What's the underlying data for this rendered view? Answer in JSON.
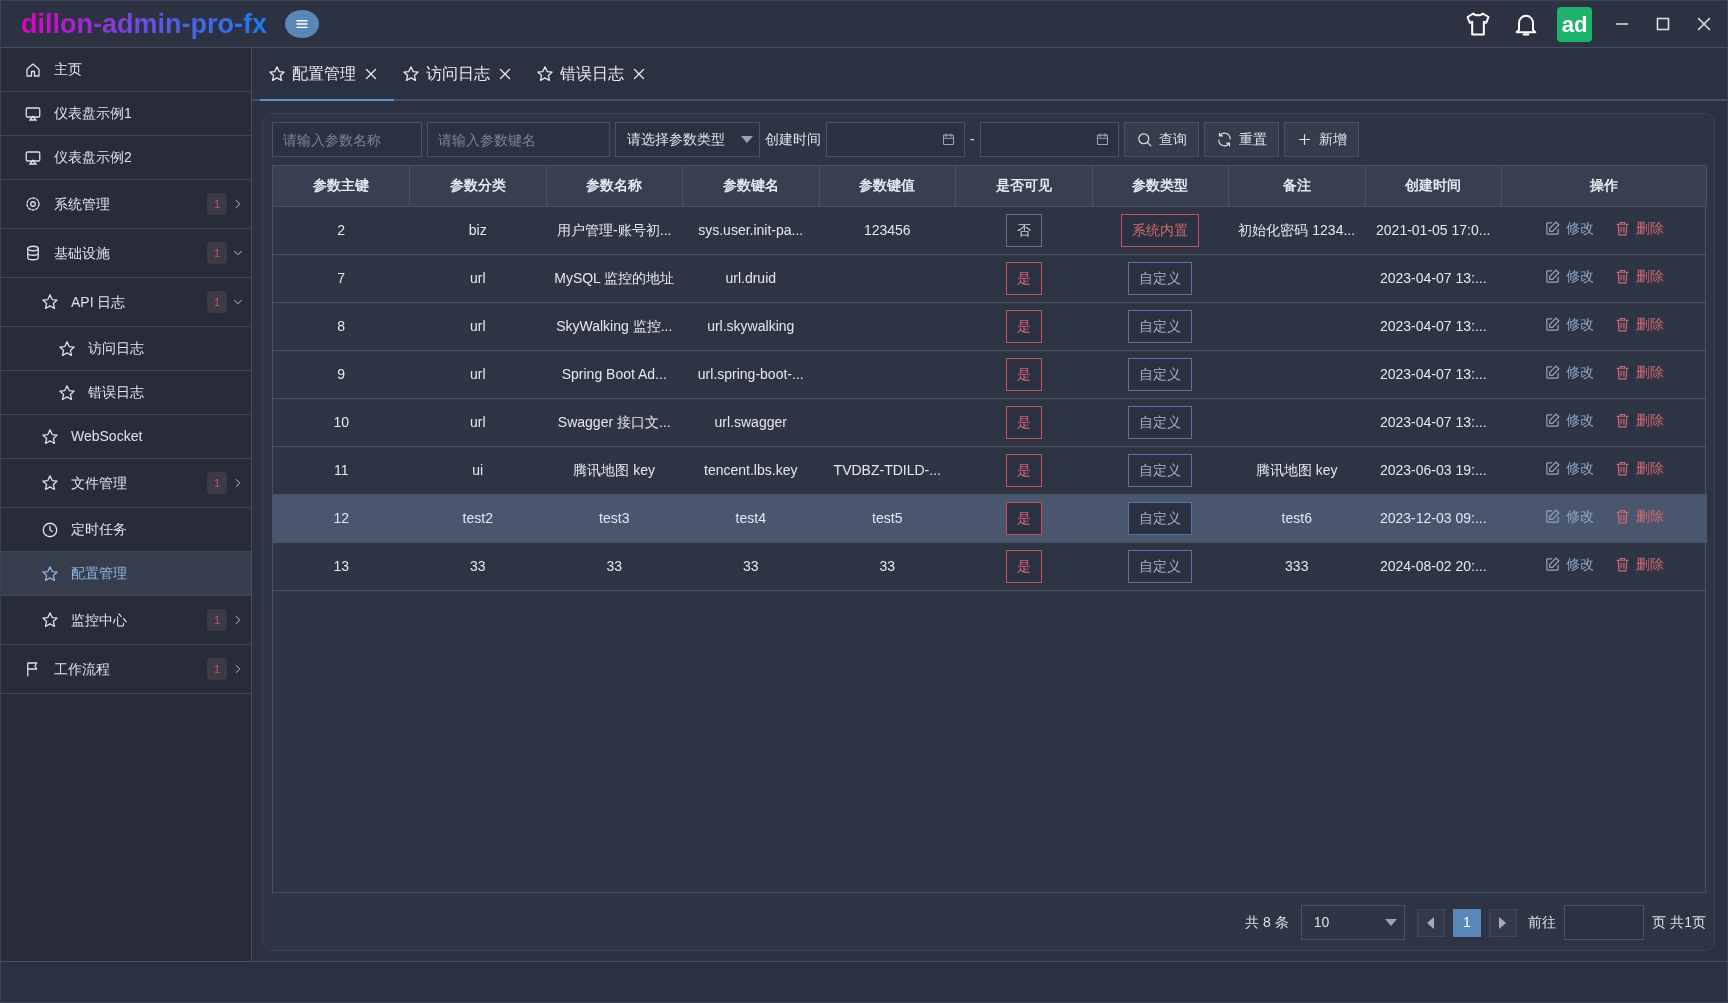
{
  "header": {
    "title": "dillon-admin-pro-fx",
    "avatar": "ad"
  },
  "sidebar": {
    "items": [
      {
        "label": "主页",
        "kind": "home",
        "selected": false
      },
      {
        "label": "仪表盘示例1",
        "kind": "monitor",
        "selected": false
      },
      {
        "label": "仪表盘示例2",
        "kind": "monitor",
        "selected": false
      },
      {
        "label": "系统管理",
        "kind": "gear",
        "selected": false,
        "badge": "1",
        "expanded": false
      },
      {
        "label": "基础设施",
        "kind": "database",
        "selected": false,
        "badge": "1",
        "expanded": true,
        "children": [
          {
            "label": "API 日志",
            "kind": "star",
            "selected": false,
            "badge": "1",
            "expanded": true,
            "children": [
              {
                "label": "访问日志",
                "kind": "star",
                "selected": false
              },
              {
                "label": "错误日志",
                "kind": "star",
                "selected": false
              }
            ]
          },
          {
            "label": "WebSocket",
            "kind": "star",
            "selected": false
          },
          {
            "label": "文件管理",
            "kind": "star",
            "selected": false,
            "badge": "1",
            "expanded": false
          },
          {
            "label": "定时任务",
            "kind": "clock",
            "selected": false
          },
          {
            "label": "配置管理",
            "kind": "star",
            "selected": true
          },
          {
            "label": "监控中心",
            "kind": "star",
            "selected": false,
            "badge": "1",
            "expanded": false
          }
        ]
      },
      {
        "label": "工作流程",
        "kind": "flag",
        "selected": false,
        "badge": "1",
        "expanded": false
      }
    ]
  },
  "tabs": [
    {
      "label": "配置管理",
      "selected": true
    },
    {
      "label": "访问日志",
      "selected": false
    },
    {
      "label": "错误日志",
      "selected": false
    }
  ],
  "toolbar": {
    "name_field": {
      "placeholder": "请输入参数名称"
    },
    "key_field": {
      "placeholder": "请输入参数键名"
    },
    "type_select": {
      "placeholder": "请选择参数类型"
    },
    "date_label": "创建时间",
    "date_separator": "-",
    "buttons": [
      {
        "label": "查询",
        "kind": "search"
      },
      {
        "label": "重置",
        "kind": "reset"
      },
      {
        "label": "新增",
        "kind": "add"
      }
    ]
  },
  "table": {
    "columns": [
      "参数主键",
      "参数分类",
      "参数名称",
      "参数键名",
      "参数键值",
      "是否可见",
      "参数类型",
      "备注",
      "创建时间",
      "操作"
    ],
    "rows": [
      {
        "id": "2",
        "category": "biz",
        "name": "用户管理-账号初...",
        "key": "sys.user.init-pa...",
        "value": "123456",
        "visible": {
          "label": "否",
          "kind": "no"
        },
        "type": {
          "label": "系统内置",
          "kind": "system"
        },
        "remark": "初始化密码 1234...",
        "created": "2021-01-05 17:0...",
        "actions": [
          "修改",
          "删除"
        ],
        "selected": false
      },
      {
        "id": "7",
        "category": "url",
        "name": "MySQL 监控的地址",
        "key": "url.druid",
        "value": "",
        "visible": {
          "label": "是",
          "kind": "yes"
        },
        "type": {
          "label": "自定义",
          "kind": "custom"
        },
        "remark": "",
        "created": "2023-04-07 13:...",
        "actions": [
          "修改",
          "删除"
        ],
        "selected": false
      },
      {
        "id": "8",
        "category": "url",
        "name": "SkyWalking 监控...",
        "key": "url.skywalking",
        "value": "",
        "visible": {
          "label": "是",
          "kind": "yes"
        },
        "type": {
          "label": "自定义",
          "kind": "custom"
        },
        "remark": "",
        "created": "2023-04-07 13:...",
        "actions": [
          "修改",
          "删除"
        ],
        "selected": false
      },
      {
        "id": "9",
        "category": "url",
        "name": "Spring Boot Ad...",
        "key": "url.spring-boot-...",
        "value": "",
        "visible": {
          "label": "是",
          "kind": "yes"
        },
        "type": {
          "label": "自定义",
          "kind": "custom"
        },
        "remark": "",
        "created": "2023-04-07 13:...",
        "actions": [
          "修改",
          "删除"
        ],
        "selected": false
      },
      {
        "id": "10",
        "category": "url",
        "name": "Swagger 接口文...",
        "key": "url.swagger",
        "value": "",
        "visible": {
          "label": "是",
          "kind": "yes"
        },
        "type": {
          "label": "自定义",
          "kind": "custom"
        },
        "remark": "",
        "created": "2023-04-07 13:...",
        "actions": [
          "修改",
          "删除"
        ],
        "selected": false
      },
      {
        "id": "11",
        "category": "ui",
        "name": "腾讯地图 key",
        "key": "tencent.lbs.key",
        "value": "TVDBZ-TDILD-...",
        "visible": {
          "label": "是",
          "kind": "yes"
        },
        "type": {
          "label": "自定义",
          "kind": "custom"
        },
        "remark": "腾讯地图 key",
        "created": "2023-06-03 19:...",
        "actions": [
          "修改",
          "删除"
        ],
        "selected": false
      },
      {
        "id": "12",
        "category": "test2",
        "name": "test3",
        "key": "test4",
        "value": "test5",
        "visible": {
          "label": "是",
          "kind": "yes"
        },
        "type": {
          "label": "自定义",
          "kind": "custom"
        },
        "remark": "test6",
        "created": "2023-12-03 09:...",
        "actions": [
          "修改",
          "删除"
        ],
        "selected": true
      },
      {
        "id": "13",
        "category": "33",
        "name": "33",
        "key": "33",
        "value": "33",
        "visible": {
          "label": "是",
          "kind": "yes"
        },
        "type": {
          "label": "自定义",
          "kind": "custom"
        },
        "remark": "333",
        "created": "2024-08-02 20:...",
        "actions": [
          "修改",
          "删除"
        ],
        "selected": false
      }
    ]
  },
  "pagination": {
    "total": "共 8 条",
    "page_size": "10",
    "pages": [
      {
        "label": "1",
        "selected": true
      }
    ],
    "goto_label": "前往",
    "page_suffix": "页 共1页"
  }
}
